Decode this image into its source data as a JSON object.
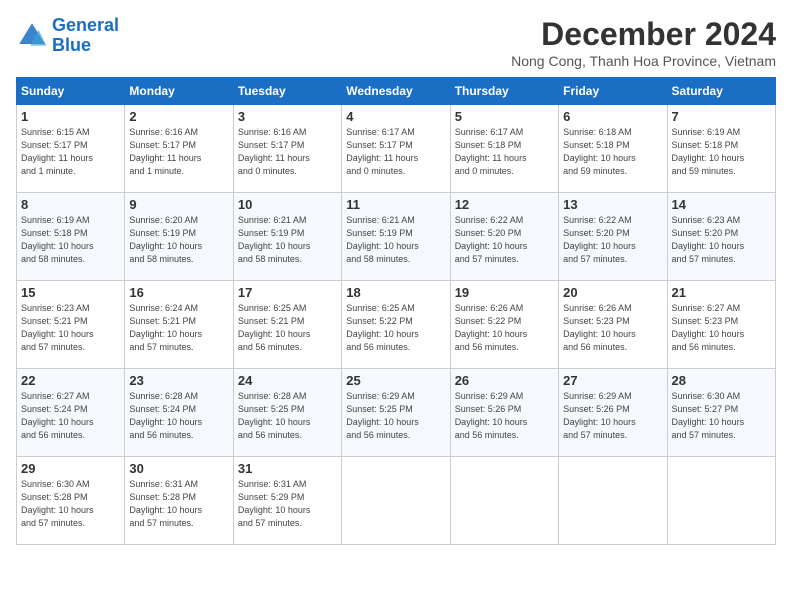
{
  "header": {
    "logo_line1": "General",
    "logo_line2": "Blue",
    "month_title": "December 2024",
    "subtitle": "Nong Cong, Thanh Hoa Province, Vietnam"
  },
  "weekdays": [
    "Sunday",
    "Monday",
    "Tuesday",
    "Wednesday",
    "Thursday",
    "Friday",
    "Saturday"
  ],
  "weeks": [
    [
      {
        "day": "1",
        "info": "Sunrise: 6:15 AM\nSunset: 5:17 PM\nDaylight: 11 hours\nand 1 minute."
      },
      {
        "day": "2",
        "info": "Sunrise: 6:16 AM\nSunset: 5:17 PM\nDaylight: 11 hours\nand 1 minute."
      },
      {
        "day": "3",
        "info": "Sunrise: 6:16 AM\nSunset: 5:17 PM\nDaylight: 11 hours\nand 0 minutes."
      },
      {
        "day": "4",
        "info": "Sunrise: 6:17 AM\nSunset: 5:17 PM\nDaylight: 11 hours\nand 0 minutes."
      },
      {
        "day": "5",
        "info": "Sunrise: 6:17 AM\nSunset: 5:18 PM\nDaylight: 11 hours\nand 0 minutes."
      },
      {
        "day": "6",
        "info": "Sunrise: 6:18 AM\nSunset: 5:18 PM\nDaylight: 10 hours\nand 59 minutes."
      },
      {
        "day": "7",
        "info": "Sunrise: 6:19 AM\nSunset: 5:18 PM\nDaylight: 10 hours\nand 59 minutes."
      }
    ],
    [
      {
        "day": "8",
        "info": "Sunrise: 6:19 AM\nSunset: 5:18 PM\nDaylight: 10 hours\nand 58 minutes."
      },
      {
        "day": "9",
        "info": "Sunrise: 6:20 AM\nSunset: 5:19 PM\nDaylight: 10 hours\nand 58 minutes."
      },
      {
        "day": "10",
        "info": "Sunrise: 6:21 AM\nSunset: 5:19 PM\nDaylight: 10 hours\nand 58 minutes."
      },
      {
        "day": "11",
        "info": "Sunrise: 6:21 AM\nSunset: 5:19 PM\nDaylight: 10 hours\nand 58 minutes."
      },
      {
        "day": "12",
        "info": "Sunrise: 6:22 AM\nSunset: 5:20 PM\nDaylight: 10 hours\nand 57 minutes."
      },
      {
        "day": "13",
        "info": "Sunrise: 6:22 AM\nSunset: 5:20 PM\nDaylight: 10 hours\nand 57 minutes."
      },
      {
        "day": "14",
        "info": "Sunrise: 6:23 AM\nSunset: 5:20 PM\nDaylight: 10 hours\nand 57 minutes."
      }
    ],
    [
      {
        "day": "15",
        "info": "Sunrise: 6:23 AM\nSunset: 5:21 PM\nDaylight: 10 hours\nand 57 minutes."
      },
      {
        "day": "16",
        "info": "Sunrise: 6:24 AM\nSunset: 5:21 PM\nDaylight: 10 hours\nand 57 minutes."
      },
      {
        "day": "17",
        "info": "Sunrise: 6:25 AM\nSunset: 5:21 PM\nDaylight: 10 hours\nand 56 minutes."
      },
      {
        "day": "18",
        "info": "Sunrise: 6:25 AM\nSunset: 5:22 PM\nDaylight: 10 hours\nand 56 minutes."
      },
      {
        "day": "19",
        "info": "Sunrise: 6:26 AM\nSunset: 5:22 PM\nDaylight: 10 hours\nand 56 minutes."
      },
      {
        "day": "20",
        "info": "Sunrise: 6:26 AM\nSunset: 5:23 PM\nDaylight: 10 hours\nand 56 minutes."
      },
      {
        "day": "21",
        "info": "Sunrise: 6:27 AM\nSunset: 5:23 PM\nDaylight: 10 hours\nand 56 minutes."
      }
    ],
    [
      {
        "day": "22",
        "info": "Sunrise: 6:27 AM\nSunset: 5:24 PM\nDaylight: 10 hours\nand 56 minutes."
      },
      {
        "day": "23",
        "info": "Sunrise: 6:28 AM\nSunset: 5:24 PM\nDaylight: 10 hours\nand 56 minutes."
      },
      {
        "day": "24",
        "info": "Sunrise: 6:28 AM\nSunset: 5:25 PM\nDaylight: 10 hours\nand 56 minutes."
      },
      {
        "day": "25",
        "info": "Sunrise: 6:29 AM\nSunset: 5:25 PM\nDaylight: 10 hours\nand 56 minutes."
      },
      {
        "day": "26",
        "info": "Sunrise: 6:29 AM\nSunset: 5:26 PM\nDaylight: 10 hours\nand 56 minutes."
      },
      {
        "day": "27",
        "info": "Sunrise: 6:29 AM\nSunset: 5:26 PM\nDaylight: 10 hours\nand 57 minutes."
      },
      {
        "day": "28",
        "info": "Sunrise: 6:30 AM\nSunset: 5:27 PM\nDaylight: 10 hours\nand 57 minutes."
      }
    ],
    [
      {
        "day": "29",
        "info": "Sunrise: 6:30 AM\nSunset: 5:28 PM\nDaylight: 10 hours\nand 57 minutes."
      },
      {
        "day": "30",
        "info": "Sunrise: 6:31 AM\nSunset: 5:28 PM\nDaylight: 10 hours\nand 57 minutes."
      },
      {
        "day": "31",
        "info": "Sunrise: 6:31 AM\nSunset: 5:29 PM\nDaylight: 10 hours\nand 57 minutes."
      },
      null,
      null,
      null,
      null
    ]
  ]
}
